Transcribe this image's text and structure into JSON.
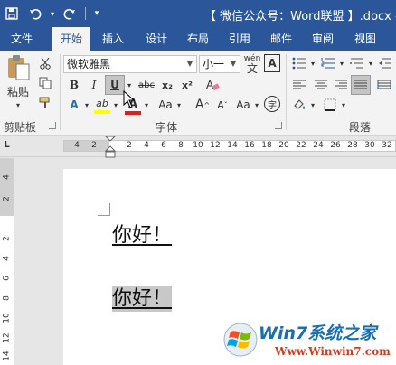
{
  "titlebar": {
    "document_title": "【 微信公众号：Word联盟 】.docx - W",
    "qat": {
      "save_icon": "save-icon",
      "undo_icon": "undo-icon",
      "redo_icon": "redo-icon",
      "customize_icon": "customize-qat-icon"
    }
  },
  "tabs": [
    {
      "label": "文件"
    },
    {
      "label": "开始"
    },
    {
      "label": "插入"
    },
    {
      "label": "设计"
    },
    {
      "label": "布局"
    },
    {
      "label": "引用"
    },
    {
      "label": "邮件"
    },
    {
      "label": "审阅"
    },
    {
      "label": "视图"
    }
  ],
  "ribbon": {
    "clipboard": {
      "paste_label": "粘贴",
      "group_label": "剪贴板"
    },
    "font": {
      "font_name": "微软雅黑",
      "font_size": "小一",
      "phonetic_label": "wén",
      "phonetic_char": "文",
      "char_border_char": "A",
      "bold": "B",
      "italic": "I",
      "underline": "U",
      "strike": "abc",
      "subscript": "x₂",
      "superscript": "x²",
      "text_effect": "A",
      "highlight": "ab",
      "font_color": "A",
      "change_case": "Aa",
      "grow": "A",
      "shrink": "A",
      "aa": "Aa",
      "enclose": "字",
      "group_label": "字体"
    },
    "paragraph": {
      "group_label": "段落"
    }
  },
  "ruler": {
    "corner": "L",
    "numbers": [
      "4",
      "2",
      "2",
      "4",
      "6",
      "8",
      "10",
      "12",
      "14",
      "16",
      "18",
      "20",
      "22",
      "24",
      "26",
      "28",
      "30",
      "32"
    ],
    "vertical_numbers": [
      "4",
      "2",
      "2",
      "4",
      "6",
      "8",
      "10",
      "12",
      "14"
    ]
  },
  "document": {
    "paragraphs": [
      {
        "text": "你好！",
        "selected": false
      },
      {
        "text": "你好！",
        "selected": true
      }
    ]
  },
  "watermark": {
    "title": "Win7系统之家",
    "url": "Www.Winwin7.com"
  }
}
